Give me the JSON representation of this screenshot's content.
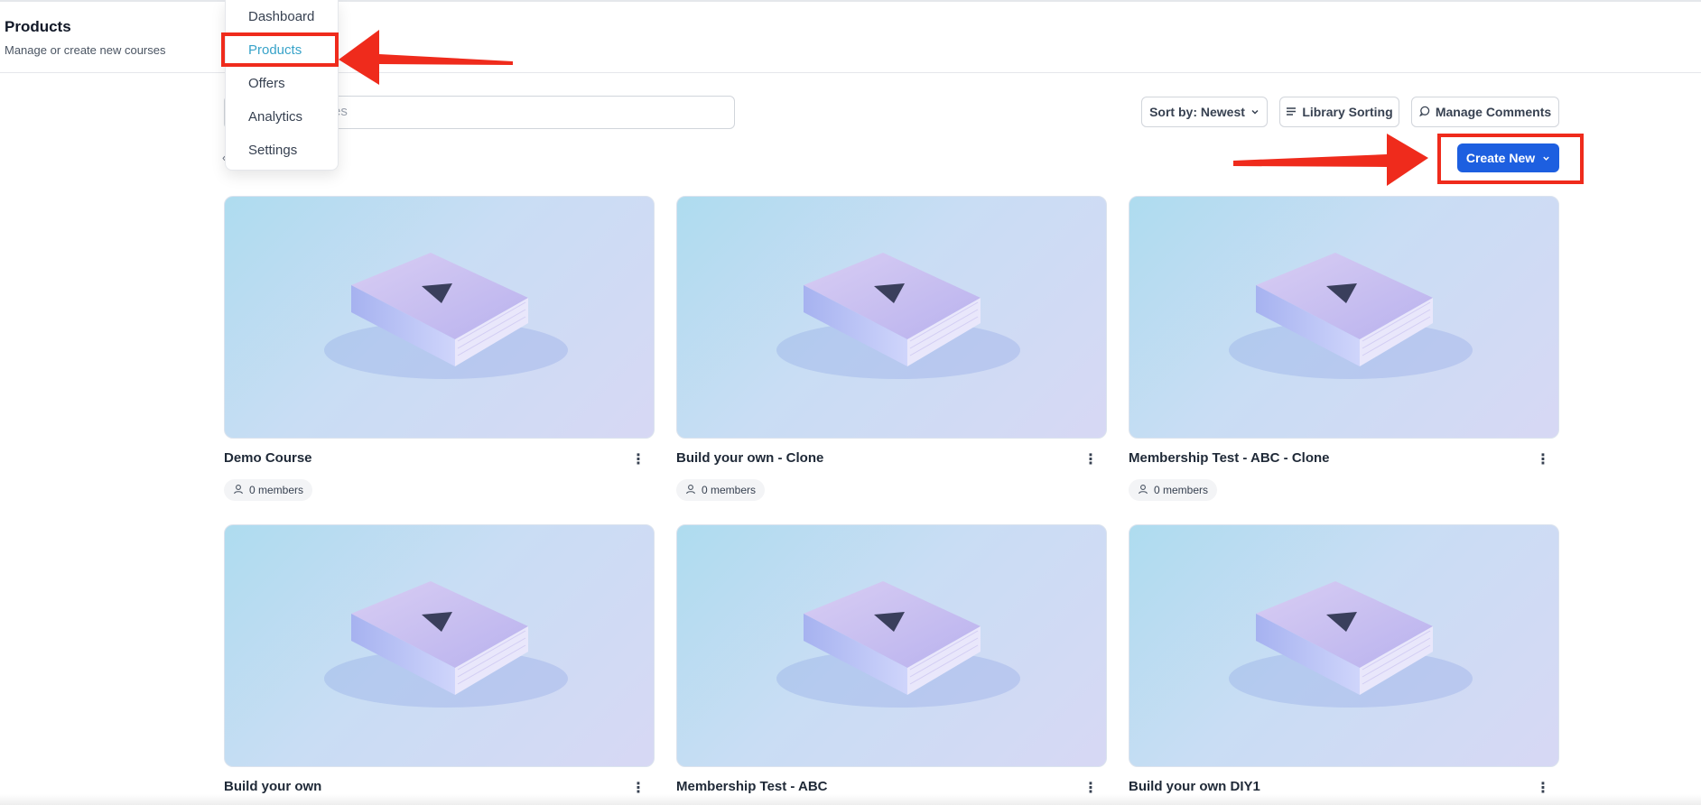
{
  "header": {
    "title": "Products",
    "subtitle": "Manage or create new courses"
  },
  "nav": {
    "items": [
      {
        "label": "Dashboard"
      },
      {
        "label": "Products"
      },
      {
        "label": "Offers"
      },
      {
        "label": "Analytics"
      },
      {
        "label": "Settings"
      }
    ],
    "active": "Products",
    "active_color": "#38a3c9"
  },
  "search": {
    "visible_placeholder_fragment": "es"
  },
  "toolbar": {
    "sort_label": "Sort by: Newest",
    "library_sorting_label": "Library Sorting",
    "manage_comments_label": "Manage Comments",
    "create_new_label": "Create New",
    "create_new_color": "#1d5fe0"
  },
  "annotation_color": "#ef2b1c",
  "cards": [
    {
      "title": "Demo Course",
      "members": "0 members"
    },
    {
      "title": "Build your own - Clone",
      "members": "0 members"
    },
    {
      "title": "Membership Test - ABC - Clone",
      "members": "0 members"
    },
    {
      "title": "Build your own",
      "members": ""
    },
    {
      "title": "Membership Test - ABC",
      "members": ""
    },
    {
      "title": "Build your own DIY1",
      "members": ""
    }
  ]
}
